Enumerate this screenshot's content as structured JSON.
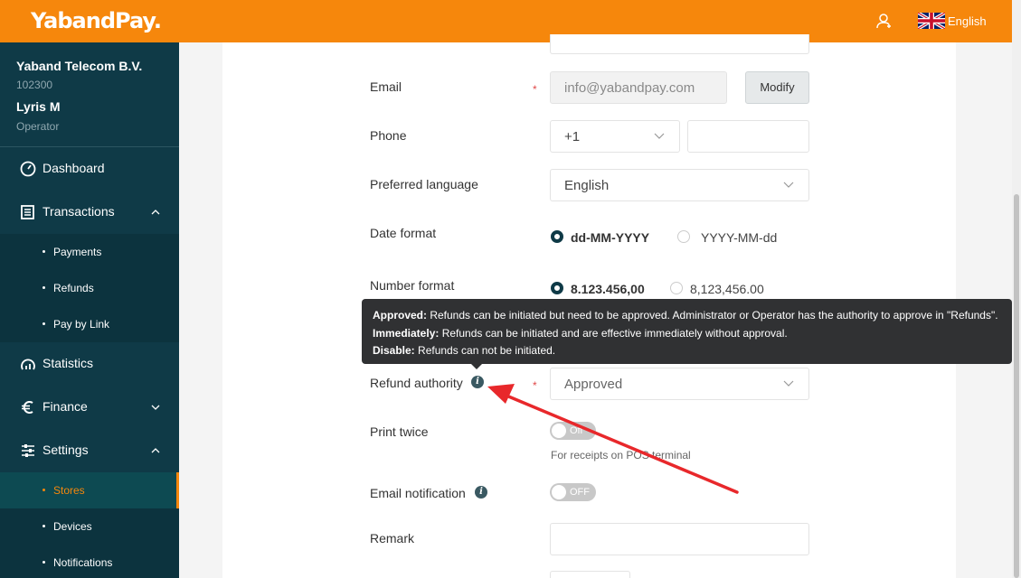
{
  "header": {
    "logo": "YabandPay.",
    "language": "English"
  },
  "sidebar": {
    "company": "Yaband Telecom B.V.",
    "company_id": "102300",
    "user_name": "Lyris M",
    "user_role": "Operator",
    "items": [
      {
        "label": "Dashboard",
        "icon": "gauge-icon"
      },
      {
        "label": "Transactions",
        "icon": "list-icon"
      },
      {
        "label": "Payments"
      },
      {
        "label": "Refunds"
      },
      {
        "label": "Pay by Link"
      },
      {
        "label": "Statistics",
        "icon": "chart-icon"
      },
      {
        "label": "Finance",
        "icon": "euro-icon"
      },
      {
        "label": "Settings",
        "icon": "sliders-icon"
      },
      {
        "label": "Stores"
      },
      {
        "label": "Devices"
      },
      {
        "label": "Notifications"
      }
    ]
  },
  "form": {
    "email_label": "Email",
    "email_value": "info@yabandpay.com",
    "modify_label": "Modify",
    "phone_label": "Phone",
    "phone_code": "+1",
    "phone_value": "",
    "language_label": "Preferred language",
    "language_value": "English",
    "date_label": "Date format",
    "date_options": [
      "dd-MM-YYYY",
      "YYYY-MM-dd"
    ],
    "number_label": "Number format",
    "number_options": [
      "8.123.456,00",
      "8,123,456.00"
    ],
    "refund_label": "Refund authority",
    "refund_value": "Approved",
    "print_label": "Print twice",
    "print_toggle": "Off",
    "print_hint": "For receipts on POS terminal",
    "email_notif_label": "Email notification",
    "email_notif_toggle": "OFF",
    "remark_label": "Remark",
    "remark_value": ""
  },
  "tooltip": {
    "approved_key": "Approved:",
    "approved_text": " Refunds can be initiated but need to be approved. Administrator or Operator has the authority to approve in \"Refunds\".",
    "immediately_key": "Immediately:",
    "immediately_text": " Refunds can be initiated and are effective immediately without approval.",
    "disable_key": "Disable:",
    "disable_text": " Refunds can not be initiated."
  },
  "colors": {
    "brand": "#f6870c",
    "sidebar": "#0f3a47",
    "annotation": "#e8282b"
  }
}
